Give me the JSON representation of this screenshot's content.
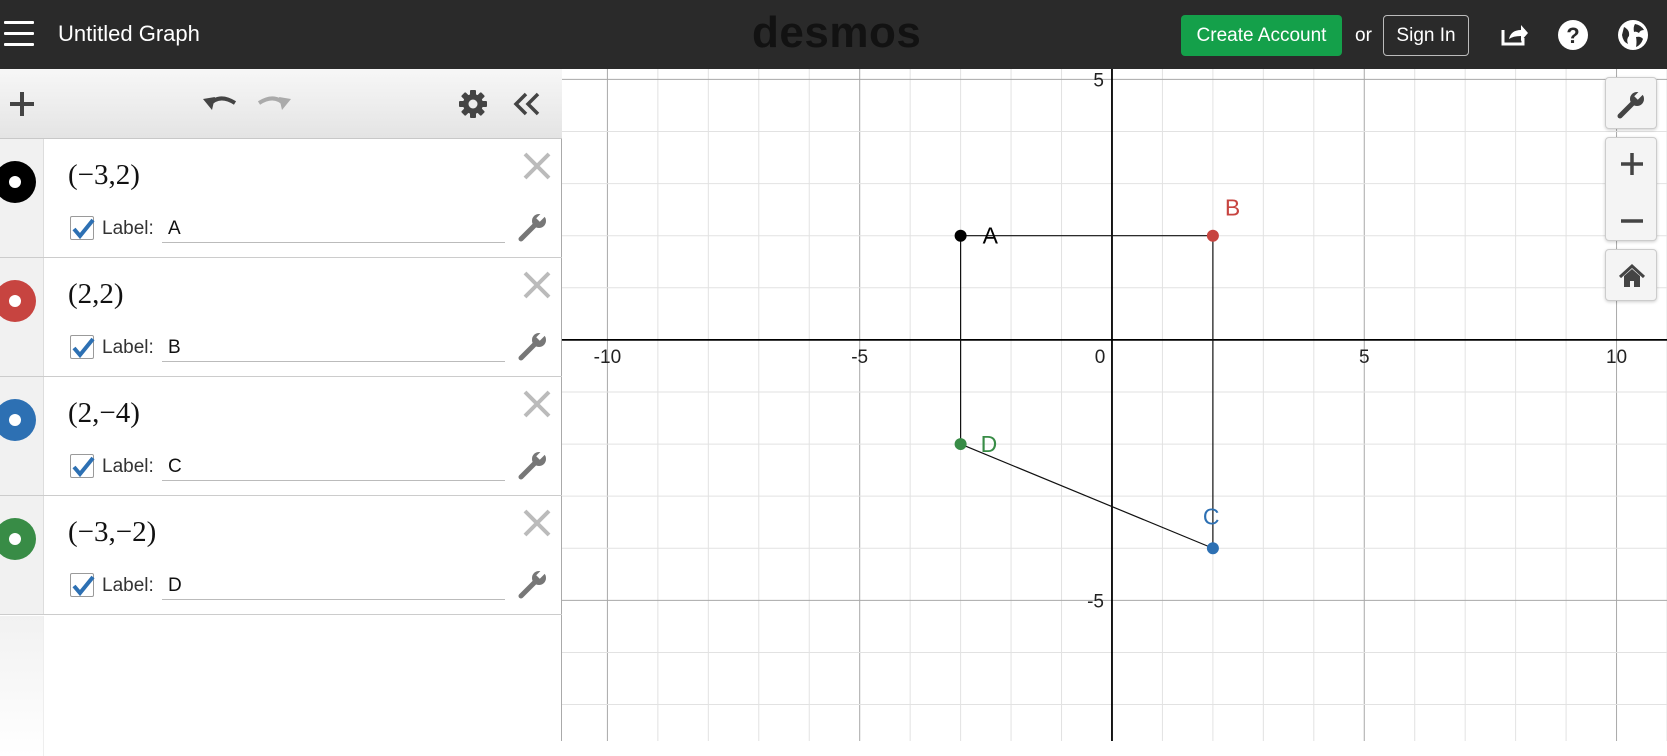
{
  "header": {
    "menu_icon": "hamburger-icon",
    "title": "Untitled Graph",
    "brand": "desmos",
    "create_account": "Create Account",
    "or_text": "or",
    "sign_in": "Sign In",
    "icons": [
      "share-icon",
      "help-icon",
      "globe-icon"
    ],
    "create_color": "#14a04a",
    "bg_color": "#2a2a2a"
  },
  "toolbar": {
    "icons": [
      "add-icon",
      "undo-icon",
      "redo-icon",
      "gear-icon",
      "collapse-icon"
    ]
  },
  "expressions": [
    {
      "math": "(−3,2)",
      "label_text": "Label:",
      "label_value": "A",
      "color": "#000000",
      "checked": true
    },
    {
      "math": "(2,2)",
      "label_text": "Label:",
      "label_value": "B",
      "color": "#c74440",
      "checked": true
    },
    {
      "math": "(2,−4)",
      "label_text": "Label:",
      "label_value": "C",
      "color": "#2d70b3",
      "checked": true
    },
    {
      "math": "(−3,−2)",
      "label_text": "Label:",
      "label_value": "D",
      "color": "#388c46",
      "checked": true
    }
  ],
  "graph": {
    "x_range": [
      -10.9,
      11.0
    ],
    "y_range": [
      -7.7,
      5.2
    ],
    "x_ticks": [
      "-10",
      "-5",
      "0",
      "5",
      "10"
    ],
    "y_ticks": [
      "5",
      "-5"
    ],
    "points": [
      {
        "label": "A",
        "x": -3,
        "y": 2,
        "color": "#000000"
      },
      {
        "label": "B",
        "x": 2,
        "y": 2,
        "color": "#c74440"
      },
      {
        "label": "C",
        "x": 2,
        "y": -4,
        "color": "#2d70b3"
      },
      {
        "label": "D",
        "x": -3,
        "y": -2,
        "color": "#388c46"
      }
    ],
    "segments": [
      [
        "A",
        "B"
      ],
      [
        "B",
        "C"
      ],
      [
        "C",
        "D"
      ],
      [
        "D",
        "A"
      ]
    ],
    "side_icons": [
      "wrench-icon",
      "zoom-in-icon",
      "zoom-out-icon",
      "home-icon"
    ]
  }
}
